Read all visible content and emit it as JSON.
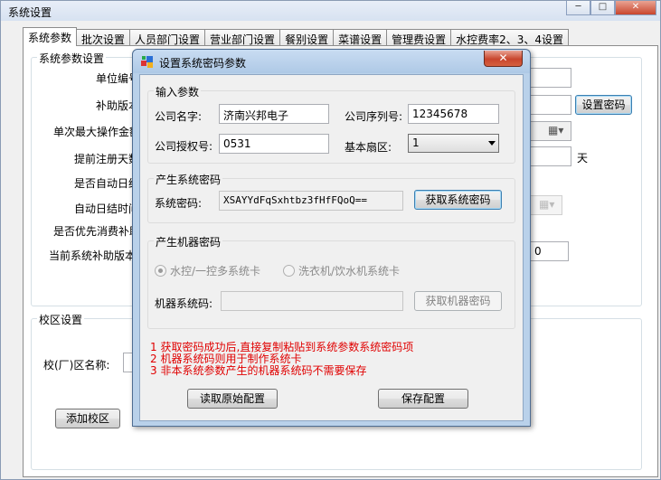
{
  "window": {
    "title": "系统设置",
    "minimize": "─",
    "maximize": "□",
    "close": "✕"
  },
  "tabs": [
    "系统参数",
    "批次设置",
    "人员部门设置",
    "营业部门设置",
    "餐别设置",
    "菜谱设置",
    "管理费设置",
    "水控费率2、3、4设置"
  ],
  "sys_params": {
    "group_title": "系统参数设置",
    "labels": [
      "单位编号",
      "补助版本",
      "单次最大操作金额",
      "提前注册天数",
      "是否自动日结",
      "自动日结时间",
      "是否优先消费补助",
      "当前系统补助版本"
    ],
    "set_password_button": "设置密码",
    "days_unit": "天",
    "current_subsidy_version": "0"
  },
  "campus": {
    "group_title": "校区设置",
    "name_label": "校(厂)区名称:",
    "add_button": "添加校区"
  },
  "dialog": {
    "title": "设置系统密码参数",
    "close": "✕",
    "input_group": {
      "title": "输入参数",
      "company_name_label": "公司名字:",
      "company_name": "济南兴邦电子",
      "company_serial_label": "公司序列号:",
      "company_serial": "12345678",
      "auth_no_label": "公司授权号:",
      "auth_no": "0531",
      "sector_label": "基本扇区:",
      "sector": "1"
    },
    "sys_pwd_group": {
      "title": "产生系统密码",
      "label": "系统密码:",
      "value": "XSAYYdFqSxhtbz3fHfFQoQ==",
      "button": "获取系统密码"
    },
    "machine_pwd_group": {
      "title": "产生机器密码",
      "radio1": "水控/一控多系统卡",
      "radio2": "洗衣机/饮水机系统卡",
      "label": "机器系统码:",
      "value": "",
      "button": "获取机器密码"
    },
    "notes": [
      "1 获取密码成功后,直接复制粘贴到系统参数系统密码项",
      "2 机器系统码则用于制作系统卡",
      "3 非本系统参数产生的机器系统码不需要保存"
    ],
    "read_button": "读取原始配置",
    "save_button": "保存配置"
  }
}
